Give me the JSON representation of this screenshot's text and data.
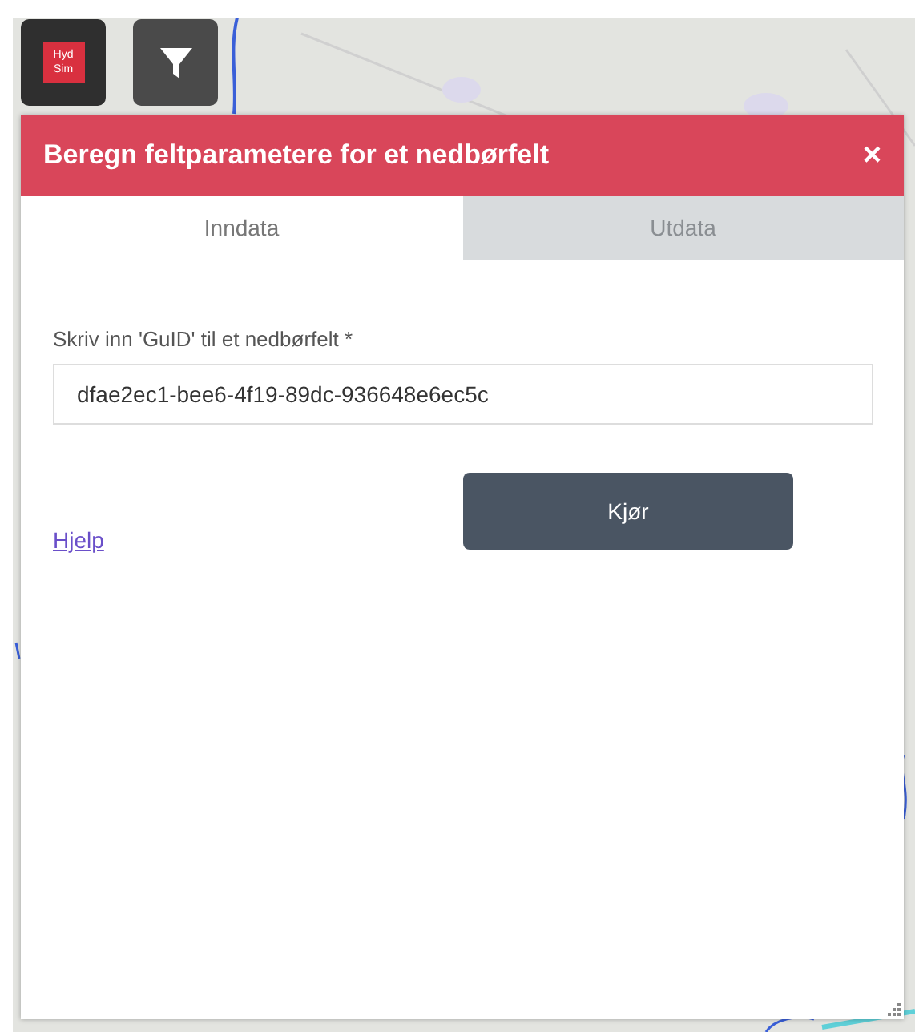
{
  "toolbar": {
    "logo": {
      "lines": [
        "Hyd",
        "Sim"
      ]
    }
  },
  "panel": {
    "title": "Beregn feltparametere for et nedbørfelt",
    "close": "×",
    "tabs": [
      {
        "label": "Inndata",
        "selected": true
      },
      {
        "label": "Utdata",
        "selected": false
      }
    ],
    "field": {
      "label": "Skriv inn 'GuID' til et nedbørfelt *",
      "value": "dfae2ec1-bee6-4f19-89dc-936648e6ec5c"
    },
    "help_link": "Hjelp",
    "run_button": "Kjør"
  }
}
